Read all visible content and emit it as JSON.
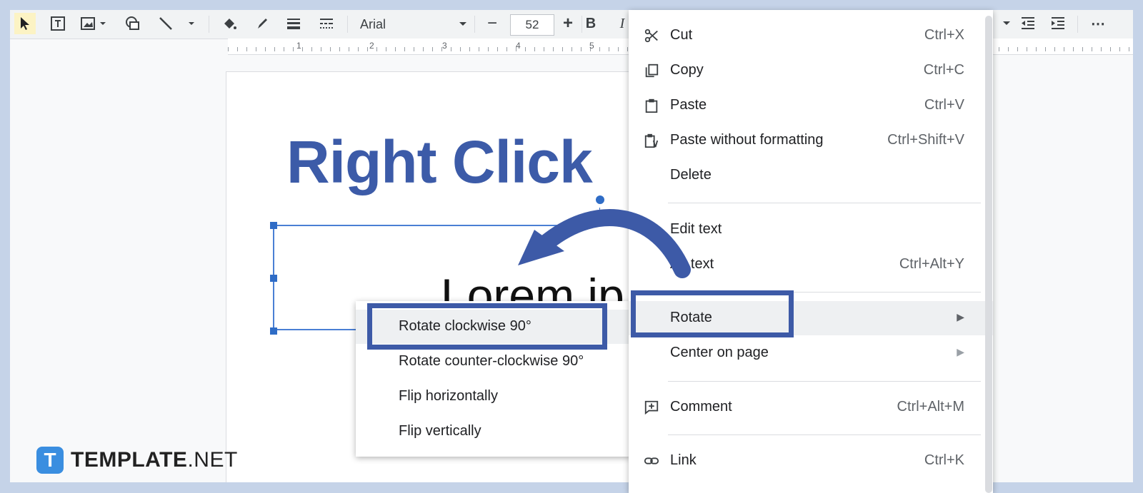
{
  "toolbar": {
    "font": "Arial",
    "font_size": "52",
    "minus": "−",
    "plus": "+",
    "bold": "B",
    "italic": "I",
    "more": "⋯"
  },
  "ruler": {
    "numbers": [
      "1",
      "2",
      "3",
      "4",
      "5"
    ]
  },
  "slide": {
    "title": "Right Click",
    "body": "Lorem ip"
  },
  "watermark": {
    "brand": "TEMPLATE",
    "suffix": ".NET"
  },
  "context_menu": {
    "items": [
      {
        "label": "Cut",
        "shortcut": "Ctrl+X",
        "icon": "scissors-icon"
      },
      {
        "label": "Copy",
        "shortcut": "Ctrl+C",
        "icon": "copy-icon"
      },
      {
        "label": "Paste",
        "shortcut": "Ctrl+V",
        "icon": "paste-icon"
      },
      {
        "label": "Paste without formatting",
        "shortcut": "Ctrl+Shift+V",
        "icon": "paste-plain-icon"
      },
      {
        "label": "Delete",
        "shortcut": ""
      },
      {
        "label": "Edit text",
        "shortcut": ""
      },
      {
        "label": "Alt text",
        "shortcut": "Ctrl+Alt+Y"
      },
      {
        "label": "Rotate",
        "shortcut": ""
      },
      {
        "label": "Center on page",
        "shortcut": ""
      },
      {
        "label": "Comment",
        "shortcut": "Ctrl+Alt+M",
        "icon": "comment-icon"
      },
      {
        "label": "Link",
        "shortcut": "Ctrl+K",
        "icon": "link-icon"
      }
    ]
  },
  "rotate_submenu": {
    "items": [
      "Rotate clockwise 90°",
      "Rotate counter-clockwise 90°",
      "Flip horizontally",
      "Flip vertically"
    ]
  },
  "colors": {
    "accent": "#3d5aa7",
    "title": "#3c5ba8",
    "selection": "#2f6cc6"
  }
}
